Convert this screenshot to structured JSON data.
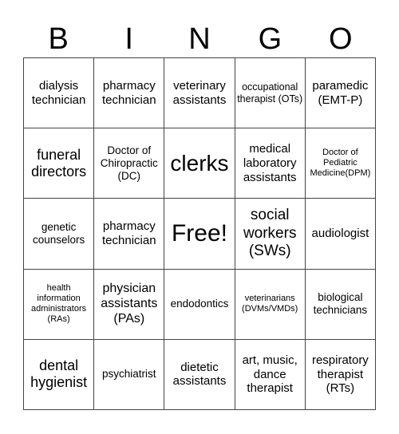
{
  "header": [
    "B",
    "I",
    "N",
    "G",
    "O"
  ],
  "cells": [
    "dialysis technician",
    "pharmacy technician",
    "veterinary assistants",
    "occupational therapist (OTs)",
    "paramedic (EMT-P)",
    "funeral directors",
    "Doctor of Chiropractic (DC)",
    "clerks",
    "medical laboratory assistants",
    "Doctor of Pediatric Medicine(DPM)",
    "genetic counselors",
    "pharmacy technician",
    "Free!",
    "social workers (SWs)",
    "audiologist",
    "health information administrators (RAs)",
    "physician assistants (PAs)",
    "endodontics",
    "veterinarians (DVMs/VMDs)",
    "biological technicians",
    "dental hygienist",
    "psychiatrist",
    "dietetic assistants",
    "art, music, dance therapist",
    "respiratory therapist (RTs)"
  ]
}
